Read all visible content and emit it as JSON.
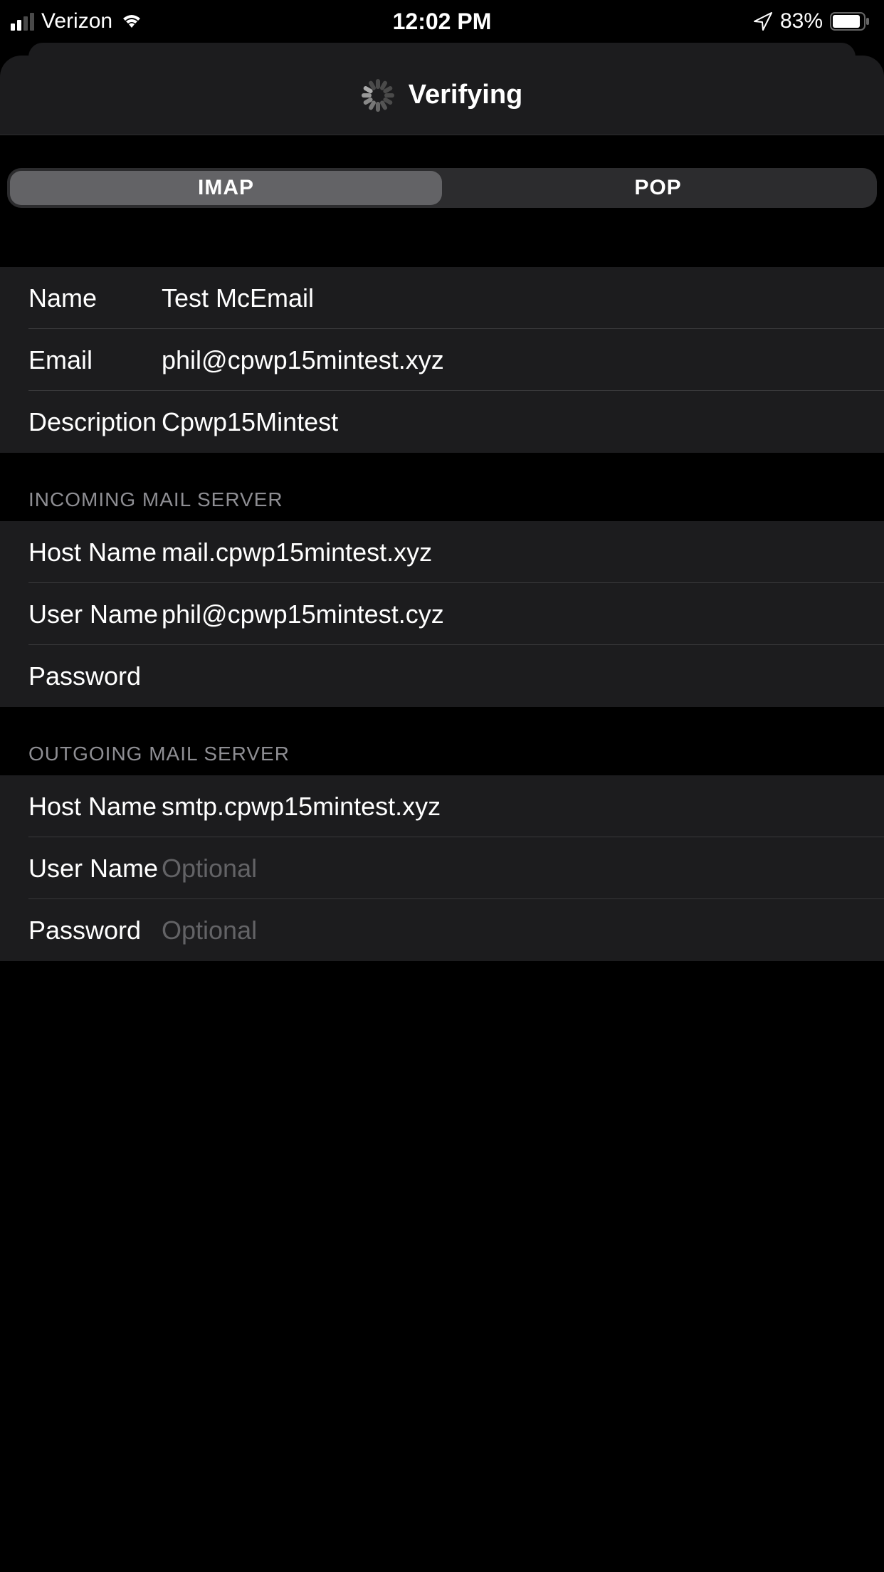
{
  "status_bar": {
    "carrier": "Verizon",
    "time": "12:02 PM",
    "battery": "83%"
  },
  "header": {
    "title": "Verifying"
  },
  "segments": {
    "imap": "IMAP",
    "pop": "POP"
  },
  "account": {
    "name_label": "Name",
    "name_value": "Test McEmail",
    "email_label": "Email",
    "email_value": "phil@cpwp15mintest.xyz",
    "description_label": "Description",
    "description_value": "Cpwp15Mintest"
  },
  "incoming": {
    "header": "INCOMING MAIL SERVER",
    "host_label": "Host Name",
    "host_value": "mail.cpwp15mintest.xyz",
    "user_label": "User Name",
    "user_value": "phil@cpwp15mintest.cyz",
    "password_label": "Password",
    "password_value": ""
  },
  "outgoing": {
    "header": "OUTGOING MAIL SERVER",
    "host_label": "Host Name",
    "host_value": "smtp.cpwp15mintest.xyz",
    "user_label": "User Name",
    "user_value": "",
    "user_placeholder": "Optional",
    "password_label": "Password",
    "password_value": "",
    "password_placeholder": "Optional"
  }
}
